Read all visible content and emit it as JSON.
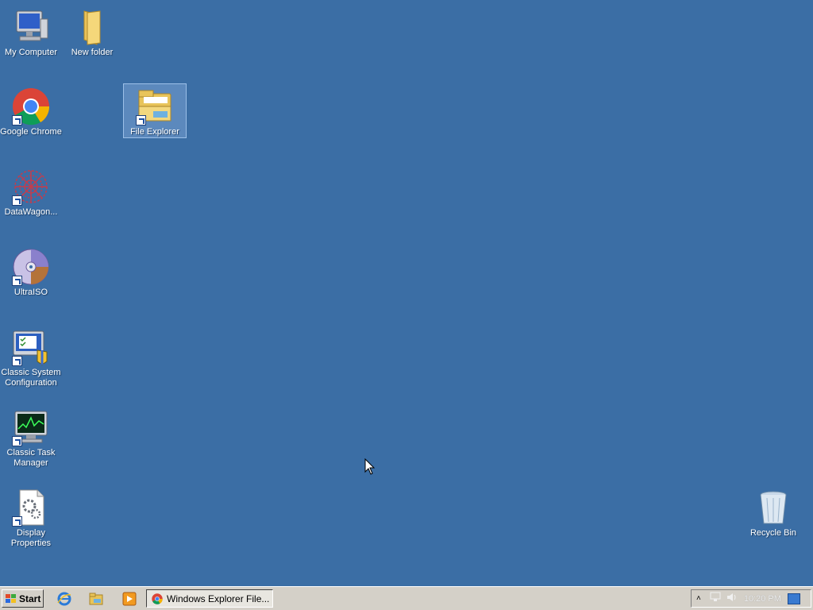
{
  "desktop": {
    "icons": [
      {
        "label": "My Computer"
      },
      {
        "label": "New folder"
      },
      {
        "label": "Google Chrome"
      },
      {
        "label": "File Explorer"
      },
      {
        "label": "DataWagon..."
      },
      {
        "label": "UltraISO"
      },
      {
        "label": "Classic System Configuration"
      },
      {
        "label": "Classic Task Manager"
      },
      {
        "label": "Display Properties"
      },
      {
        "label": "Recycle Bin"
      }
    ],
    "selected_icon": "File Explorer",
    "background_color": "#3b6ea5"
  },
  "taskbar": {
    "start_label": "Start",
    "quick_launch": [
      "internet-explorer-icon",
      "file-explorer-icon",
      "media-player-icon"
    ],
    "tasks": [
      {
        "label": "Windows Explorer File...",
        "icon": "chrome-icon"
      }
    ],
    "tray": {
      "icons": [
        "show-hidden-icons-chevron",
        "network-icon",
        "volume-icon"
      ],
      "clock": "10:20 PM"
    }
  }
}
